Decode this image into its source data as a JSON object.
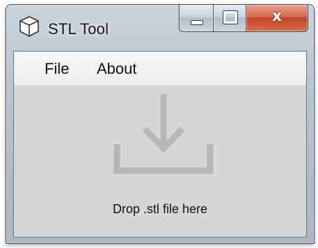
{
  "window": {
    "title": "STL Tool",
    "app_icon": "cube-icon",
    "caption_buttons": {
      "minimize_icon": "minimize-icon",
      "maximize_icon": "maximize-icon",
      "close_glyph": "x"
    }
  },
  "menu": {
    "items": [
      {
        "label": "File"
      },
      {
        "label": "About"
      }
    ]
  },
  "drop_zone": {
    "icon": "download-tray-icon",
    "text": "Drop .stl file here"
  },
  "colors": {
    "client_background": "#d6d6d6",
    "menubar_background": "#f2f2f2",
    "drop_icon": "#b7b7b7",
    "close_button": "#c9472c"
  }
}
